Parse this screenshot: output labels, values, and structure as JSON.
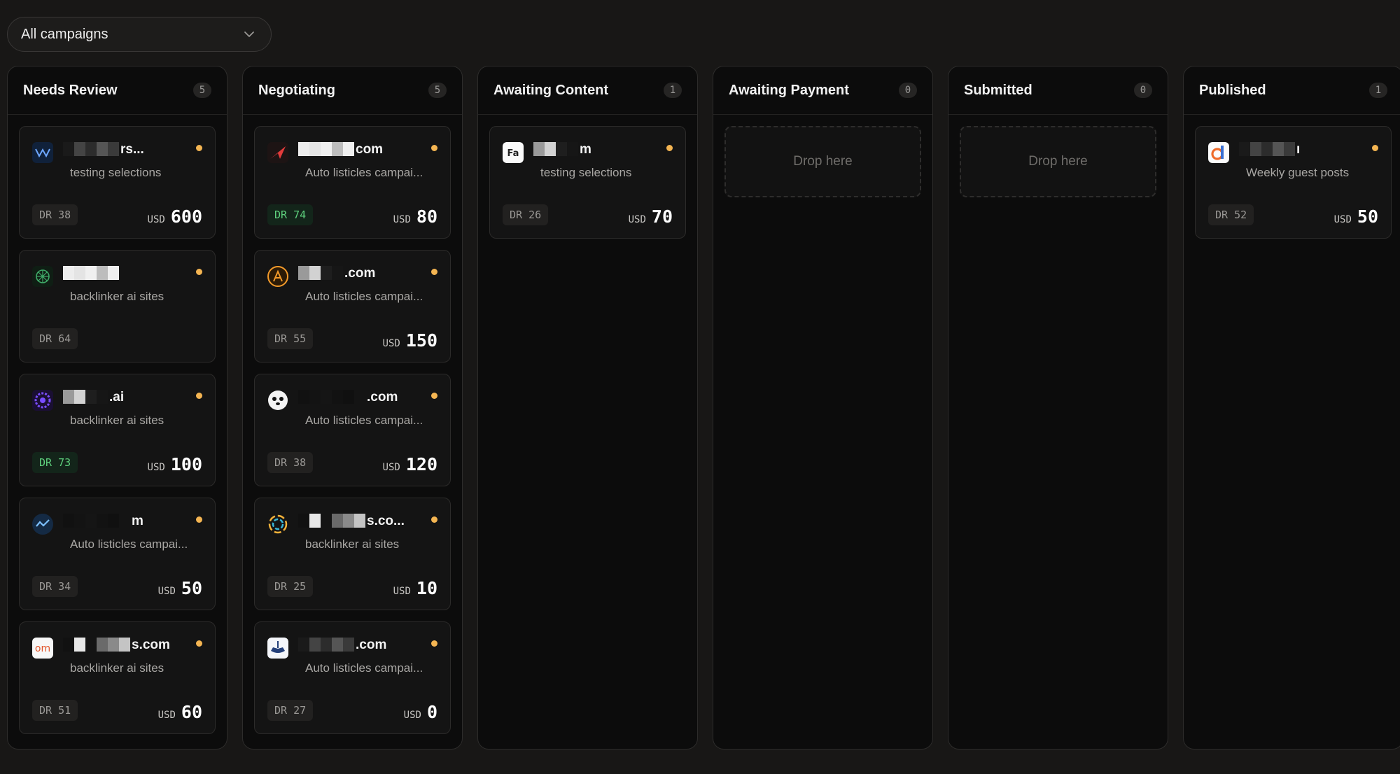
{
  "filter": {
    "label": "All campaigns",
    "icon": "chevron-down-icon"
  },
  "colors": {
    "accent_dot": "#f4b552",
    "dr_high": "#5ed07d"
  },
  "columns": [
    {
      "title": "Needs Review",
      "count": "5",
      "cards": [
        {
          "site_suffix": "rs...",
          "campaign": "testing selections",
          "dr": "DR 38",
          "dr_high": false,
          "currency": "USD",
          "price": "600",
          "icon": "wave-logo-icon"
        },
        {
          "site_suffix": "",
          "campaign": "backlinker ai sites",
          "dr": "DR 64",
          "dr_high": false,
          "currency": "",
          "price": "",
          "icon": "network-logo-icon"
        },
        {
          "site_suffix": ".ai",
          "campaign": "backlinker ai sites",
          "dr": "DR 73",
          "dr_high": true,
          "currency": "USD",
          "price": "100",
          "icon": "gear-logo-icon"
        },
        {
          "site_suffix": "m",
          "campaign": "Auto listicles campai...",
          "dr": "DR 34",
          "dr_high": false,
          "currency": "USD",
          "price": "50",
          "icon": "chart-logo-icon"
        },
        {
          "site_suffix": "s.com",
          "campaign": "backlinker ai sites",
          "dr": "DR 51",
          "dr_high": false,
          "currency": "USD",
          "price": "60",
          "icon": "om-logo-icon"
        }
      ]
    },
    {
      "title": "Negotiating",
      "count": "5",
      "cards": [
        {
          "site_suffix": "com",
          "campaign": "Auto listicles campai...",
          "dr": "DR 74",
          "dr_high": true,
          "currency": "USD",
          "price": "80",
          "icon": "arrow-logo-icon"
        },
        {
          "site_suffix": ".com",
          "campaign": "Auto listicles campai...",
          "dr": "DR 55",
          "dr_high": false,
          "currency": "USD",
          "price": "150",
          "icon": "circle-a-logo-icon"
        },
        {
          "site_suffix": ".com",
          "campaign": "Auto listicles campai...",
          "dr": "DR 38",
          "dr_high": false,
          "currency": "USD",
          "price": "120",
          "icon": "panda-logo-icon"
        },
        {
          "site_suffix": "s.co...",
          "campaign": "backlinker ai sites",
          "dr": "DR 25",
          "dr_high": false,
          "currency": "USD",
          "price": "10",
          "icon": "spiral-logo-icon"
        },
        {
          "site_suffix": ".com",
          "campaign": "Auto listicles campai...",
          "dr": "DR 27",
          "dr_high": false,
          "currency": "USD",
          "price": "0",
          "icon": "ship-logo-icon"
        }
      ]
    },
    {
      "title": "Awaiting Content",
      "count": "1",
      "cards": [
        {
          "site_suffix": "m",
          "campaign": "testing selections",
          "dr": "DR 26",
          "dr_high": false,
          "currency": "USD",
          "price": "70",
          "icon": "fa-logo-icon"
        }
      ]
    },
    {
      "title": "Awaiting Payment",
      "count": "0",
      "drop_label": "Drop here",
      "cards": []
    },
    {
      "title": "Submitted",
      "count": "0",
      "drop_label": "Drop here",
      "cards": []
    },
    {
      "title": "Published",
      "count": "1",
      "cards": [
        {
          "site_suffix": "ı",
          "campaign": "Weekly guest posts",
          "dr": "DR 52",
          "dr_high": false,
          "currency": "USD",
          "price": "50",
          "icon": "d-logo-icon"
        }
      ]
    }
  ]
}
